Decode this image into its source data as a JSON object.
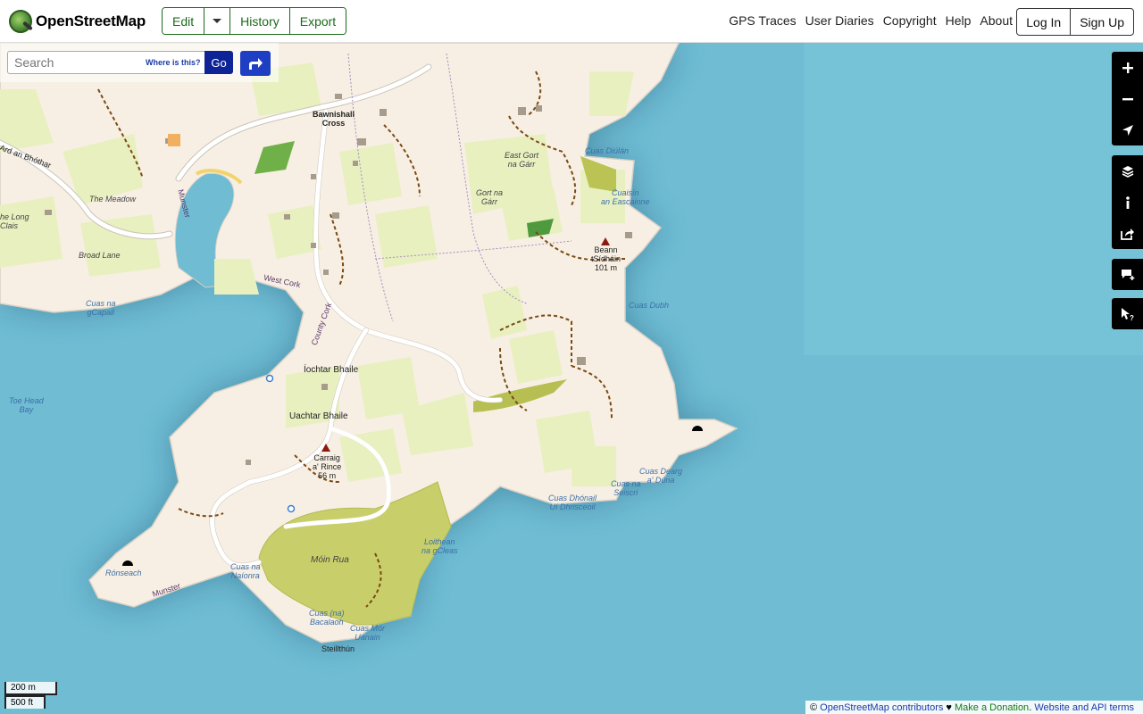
{
  "header": {
    "logo_text": "OpenStreetMap",
    "edit_label": "Edit",
    "history_label": "History",
    "export_label": "Export",
    "nav": [
      "GPS Traces",
      "User Diaries",
      "Copyright",
      "Help",
      "About"
    ],
    "login_label": "Log In",
    "signup_label": "Sign Up"
  },
  "search": {
    "placeholder": "Search",
    "where_label": "Where is this?",
    "go_label": "Go"
  },
  "controls": {
    "zoom_in": "zoom-in-icon",
    "zoom_out": "zoom-out-icon",
    "locate": "locate-arrow-icon",
    "layers": "layers-icon",
    "info": "info-icon",
    "share": "share-icon",
    "note": "add-note-icon",
    "query": "query-cursor-icon"
  },
  "map_labels": {
    "bawnishall": "Bawnishall\nCross",
    "ard_an_bhothair": "Ard an Bhóthar",
    "the_meadow": "The Meadow",
    "the_long_clais": "he Long\nClais",
    "broad_lane": "Broad Lane",
    "munster_top": "Munster",
    "cuas_gcapall": "Cuas na\ngCapall",
    "west_cork": "West Cork",
    "county_cork": "County Cork",
    "toe_head_bay": "Toe Head\nBay",
    "iochtar_bhaile": "Íochtar Bhaile",
    "uachtar_bhaile": "Uachtar Bhaile",
    "carraig_rince": "Carraig\na' Rince\n56 m",
    "east_gort": "East Gort\nna Gárr",
    "gort_na_garr": "Gort na\nGárr",
    "cuas_diulan": "Cuas Diúlán",
    "cuaisin": "Cuaisín\nan Eascainne",
    "beann_sidhain": "Beann\ntSídháin\n101 m",
    "cuas_dubh": "Cuas Dubh",
    "cuas_dearg": "Cuas Dearg\na' Dúna",
    "cuas_seiscri": "Cuas na\nSeiscri",
    "cuas_dhonail": "Cuas Dhónail\nUí Dhrisceoil",
    "loithean": "Loithean\nna gCleas",
    "moin_rua": "Móin Rua",
    "cuas_naionra": "Cuas na\nNaíonra",
    "ronseach": "Rónseach",
    "munster_bottom": "Munster",
    "cuas_bacalaoh": "Cuas (na)\nBacalaoh",
    "cuas_mor": "Cuas Mór\nUanain",
    "steillthun": "Steillthún"
  },
  "scale": {
    "metric": "200 m",
    "imperial": "500 ft"
  },
  "attribution": {
    "copy": "© ",
    "osm": "OpenStreetMap contributors",
    "heart": " ♥ ",
    "donate": "Make a Donation",
    "dot": ". ",
    "terms": "Website and API terms"
  },
  "colors": {
    "sea": "#6fbcd3",
    "land": "#f7efe3",
    "field": "#e8f0c0",
    "heath": "#c8cf6a",
    "brand_green": "#1b6b1b",
    "go_blue": "#0d2396"
  }
}
